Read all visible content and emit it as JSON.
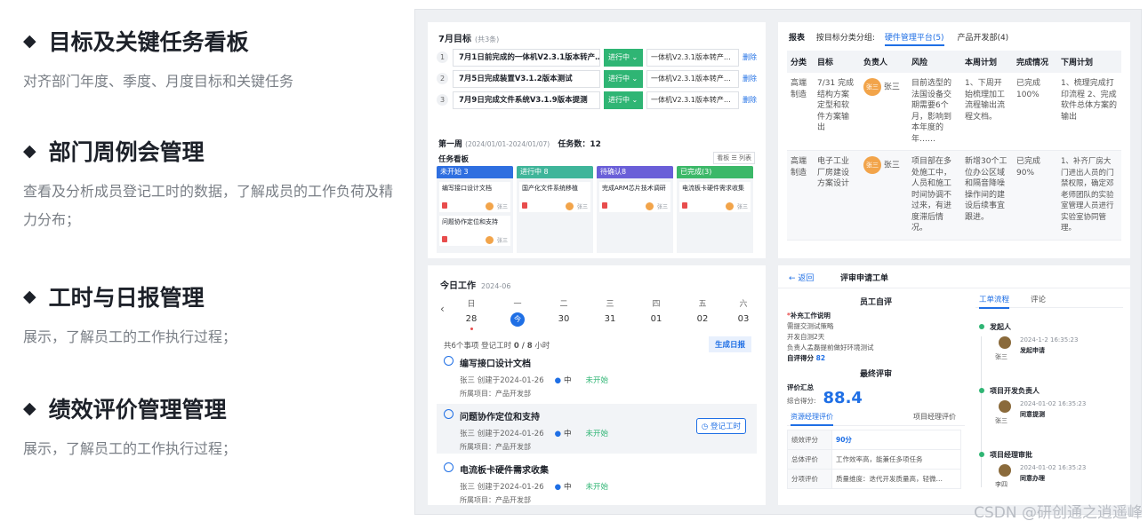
{
  "features": [
    {
      "title": "目标及关键任务看板",
      "desc": "对齐部门年度、季度、月度目标和关键任务"
    },
    {
      "title": "部门周例会管理",
      "desc": "查看及分析成员登记工时的数据，了解成员的工作负荷及精力分布；"
    },
    {
      "title": "工时与日报管理",
      "desc": "展示，了解员工的工作执行过程；"
    },
    {
      "title": "绩效评价管理管理",
      "desc": "展示，了解员工的工作执行过程；"
    }
  ],
  "goals": {
    "title": "7月目标",
    "count": "(共3条)",
    "rows": [
      {
        "num": "1",
        "text": "7月1日前完成的一体机V2.3.1版本转产…",
        "status": "进行中 ⌄",
        "link": "一体机V2.3.1版本转产…",
        "del": "删除"
      },
      {
        "num": "2",
        "text": "7月5日完成装置V3.1.2版本测试",
        "status": "进行中 ⌄",
        "link": "一体机V2.3.1版本转产…",
        "del": "删除"
      },
      {
        "num": "3",
        "text": "7月9日完成文件系统V3.1.9版本提测",
        "status": "进行中 ⌄",
        "link": "一体机V2.3.1版本转产…",
        "del": "删除"
      }
    ],
    "week": "第一周",
    "week_range": "(2024/01/01-2024/01/07)",
    "task_count": "任务数：12",
    "board_label": "任务看板",
    "view_toggle": "看板 ☰ 列表",
    "columns": [
      {
        "head": "未开始 3",
        "color": "#2f6fe0",
        "cards": [
          {
            "title": "编写接口设计文档",
            "user": "张三"
          },
          {
            "title": "问题协作定位和支持",
            "user": "张三"
          }
        ]
      },
      {
        "head": "进行中 8",
        "color": "#3fb59a",
        "cards": [
          {
            "title": "国产化文件系统移植",
            "user": "张三"
          }
        ]
      },
      {
        "head": "待确认8",
        "color": "#6a5fd8",
        "cards": [
          {
            "title": "完成ARM芯片技术调研",
            "user": "张三"
          }
        ]
      },
      {
        "head": "已完成(3)",
        "color": "#3bb868",
        "cards": [
          {
            "title": "电流板卡硬件需求收集",
            "user": "张三"
          }
        ]
      }
    ]
  },
  "report": {
    "label": "报表",
    "group_label": "按目标分类分组:",
    "tab_active": "硬件管理平台(5)",
    "tab_other": "产品开发部(4)",
    "headers": [
      "分类",
      "目标",
      "负责人",
      "风险",
      "本周计划",
      "完成情况",
      "下周计划"
    ],
    "rows": [
      {
        "cat": "高端制造",
        "goal": "7/31 完成结构方案定型和软件方案输出",
        "avatar": "张三",
        "owner": "张三",
        "risk": "目前选型的法国设备交期需要6个月，影响到本年度的年……",
        "plan": "1、下周开始梳理加工流程输出流程文档。",
        "done": "已完成 100%",
        "next": "1、梳理完成打印流程 2、完成软件总体方案的输出"
      },
      {
        "cat": "高端制造",
        "goal": "电子工业厂房建设方案设计",
        "avatar": "张三",
        "owner": "张三",
        "risk": "项目部在多处施工中，人员和施工时间协调不过来，有进度滞后情况。",
        "plan": "新增30个工位办公区域和隔音降噪操作间的建设后续事宜跟进。",
        "done": "已完成 90%",
        "next": "1、补齐厂房大门进出人员的门禁权限，确定邓老师团队的实验室管理人员进行实验室协同管理。"
      }
    ]
  },
  "today": {
    "title": "今日工作",
    "date": "2024-06",
    "nav": "‹",
    "days": [
      {
        "wd": "日",
        "dn": "28",
        "dot": true,
        "on": false
      },
      {
        "wd": "一",
        "dn": "今",
        "dot": false,
        "on": true
      },
      {
        "wd": "二",
        "dn": "30",
        "dot": false,
        "on": false
      },
      {
        "wd": "三",
        "dn": "31",
        "dot": false,
        "on": false
      },
      {
        "wd": "四",
        "dn": "01",
        "dot": false,
        "on": false
      },
      {
        "wd": "五",
        "dn": "02",
        "dot": false,
        "on": false
      },
      {
        "wd": "六",
        "dn": "03",
        "dot": false,
        "on": false
      }
    ],
    "summary_prefix": "共6个事项  登记工时",
    "summary_hours": "0 / 8",
    "summary_unit": "小时",
    "gen_btn": "生成日报",
    "tasks": [
      {
        "name": "编写接口设计文档",
        "meta": "张三  创建于2024-01-26",
        "pri": "中",
        "status": "未开始",
        "project": "所属项目：产品开发部",
        "hl": false
      },
      {
        "name": "问题协作定位和支持",
        "meta": "张三  创建于2024-01-26",
        "pri": "中",
        "status": "未开始",
        "project": "所属项目：产品开发部",
        "hl": true,
        "btn": "登记工时"
      },
      {
        "name": "电流板卡硬件需求收集",
        "meta": "张三  创建于2024-01-26",
        "pri": "中",
        "status": "未开始",
        "project": "所属项目：产品开发部",
        "hl": false
      }
    ]
  },
  "review": {
    "back": "← 返回",
    "title": "评审申请工单",
    "self_title": "员工自评",
    "supp_label": "补充工作说明",
    "supp_lines": [
      "需提交测试策略",
      "开发自测2天",
      "负责人孟磊提前做好环境测试"
    ],
    "self_score_label": "自评得分",
    "self_score": "82",
    "final_title": "最终评审",
    "summary_label": "评价汇总",
    "total_label": "综合得分:",
    "total_score": "88.4",
    "tab1": "资源经理评价",
    "tab2": "项目经理评价",
    "eval_rows": [
      {
        "k": "绩效评分",
        "v": "90分"
      },
      {
        "k": "总体评价",
        "v": "工作效率高，能兼任多项任务"
      },
      {
        "k": "分项评价",
        "v": "质量维度：迭代开发质量高，轻微…"
      }
    ],
    "flow_tab": "工单流程",
    "comment_tab": "评论",
    "steps": [
      {
        "name": "发起人",
        "user": "张三",
        "time": "2024-1-2 16:35:23",
        "action": "发起申请"
      },
      {
        "name": "项目开发负责人",
        "user": "张三",
        "time": "2024-01-02 16:35:23",
        "action": "同意提测"
      },
      {
        "name": "项目经理审批",
        "user": "李四",
        "time": "2024-01-02 16:35:23",
        "action": "同意办理"
      }
    ]
  },
  "footer": {
    "csdn": "CSDN @研创通之逍遥峰"
  }
}
